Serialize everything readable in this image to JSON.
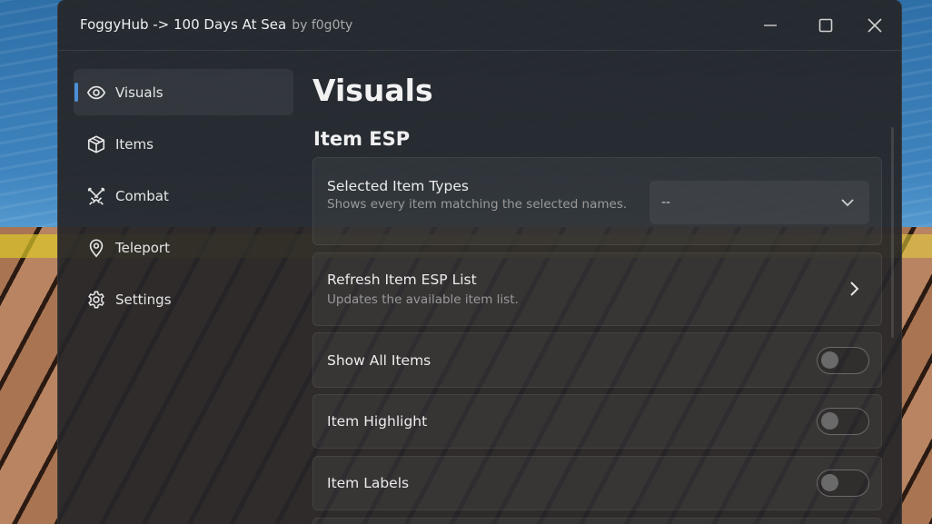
{
  "window": {
    "title": "FoggyHub -> 100 Days At Sea",
    "author": "by f0g0ty"
  },
  "sidebar": {
    "items": [
      {
        "label": "Visuals",
        "icon": "eye-icon",
        "active": true
      },
      {
        "label": "Items",
        "icon": "cube-icon",
        "active": false
      },
      {
        "label": "Combat",
        "icon": "crossed-swords-icon",
        "active": false
      },
      {
        "label": "Teleport",
        "icon": "map-pin-icon",
        "active": false
      },
      {
        "label": "Settings",
        "icon": "gear-icon",
        "active": false
      }
    ]
  },
  "main": {
    "page_title": "Visuals",
    "section_title": "Item ESP",
    "selected_item_types": {
      "title": "Selected Item Types",
      "description": "Shows every item matching the selected names.",
      "value": "--"
    },
    "refresh_list": {
      "title": "Refresh Item ESP List",
      "description": "Updates the available item list."
    },
    "toggles": [
      {
        "label": "Show All Items",
        "enabled": false
      },
      {
        "label": "Item Highlight",
        "enabled": false
      },
      {
        "label": "Item Labels",
        "enabled": false
      }
    ]
  },
  "colors": {
    "accent": "#4c8fd6",
    "panel": "#262628"
  }
}
